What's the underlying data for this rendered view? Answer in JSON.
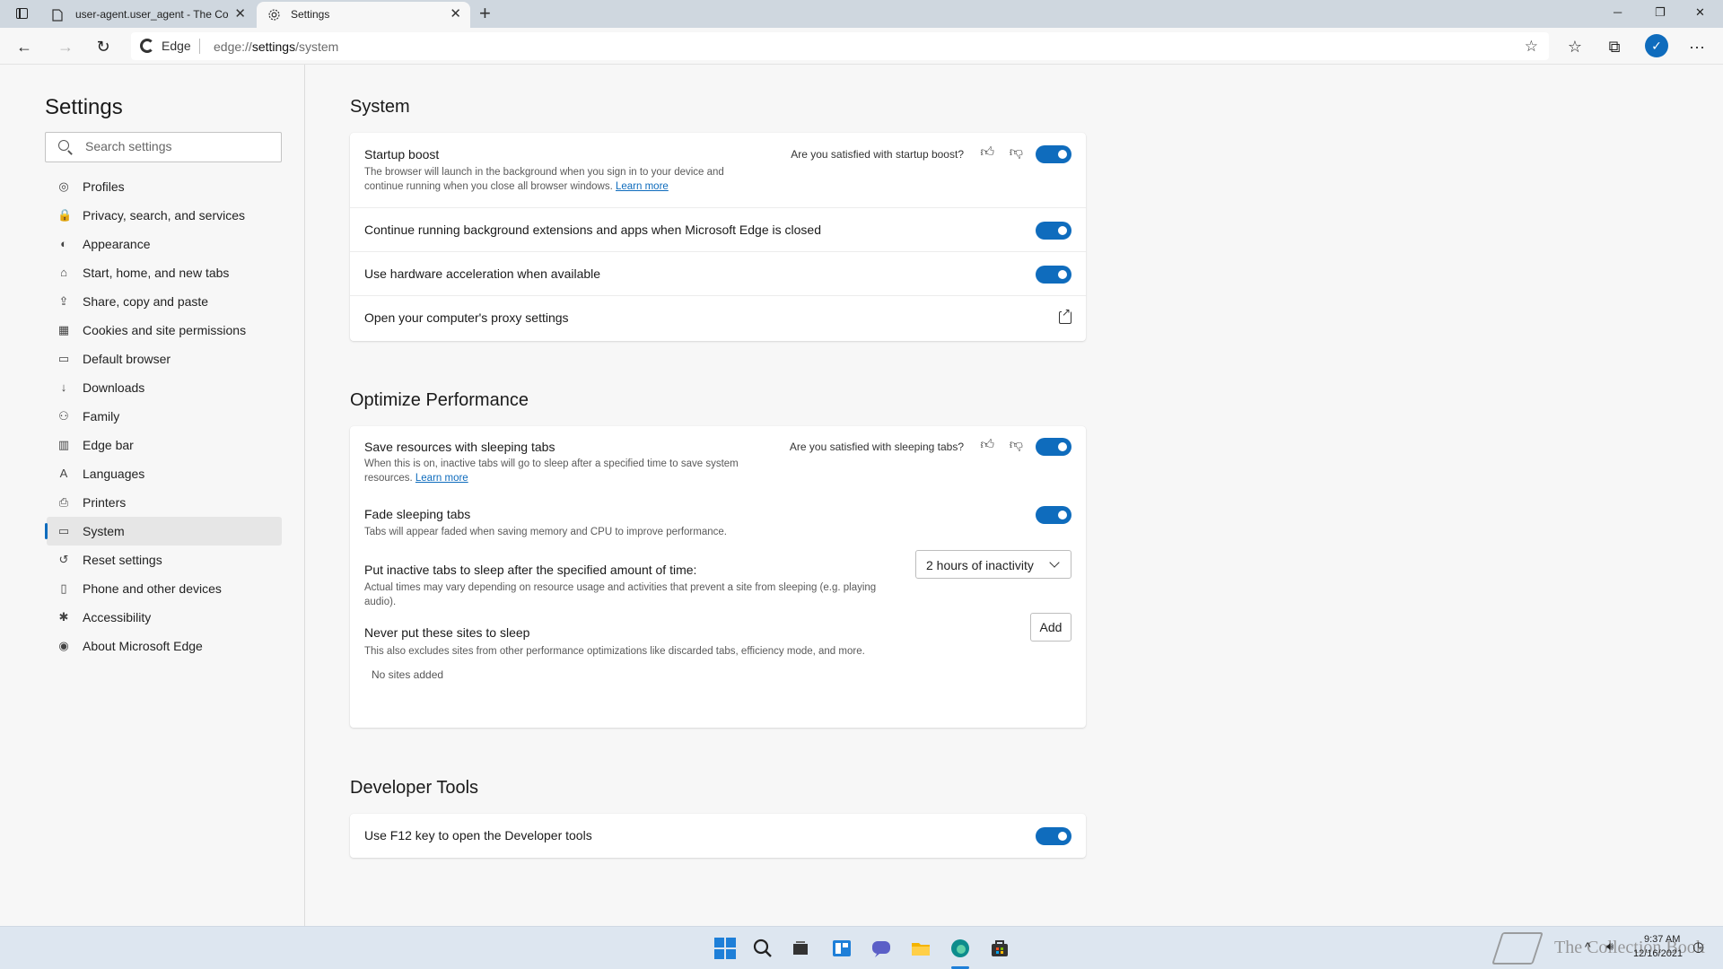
{
  "browser": {
    "tabs": [
      {
        "title": "user-agent.user_agent - The Coll",
        "close": "✕",
        "icon": "page-icon"
      },
      {
        "title": "Settings",
        "close": "✕",
        "icon": "gear-icon"
      }
    ],
    "new_tab": "+",
    "window_controls": {
      "minimize": "─",
      "restore": "❐",
      "close": "✕"
    },
    "address": {
      "chip": "Edge",
      "url_prefix": "edge://",
      "url_main": "settings",
      "url_suffix": "/system"
    },
    "toolbar_icons": {
      "back": "←",
      "forward": "→",
      "refresh": "↻",
      "add_favorite": "☆",
      "favorites": "☆",
      "collections": "⧉",
      "more": "···"
    }
  },
  "sidebar": {
    "title": "Settings",
    "search_placeholder": "Search settings",
    "items": [
      {
        "label": "Profiles",
        "icon": "profile-icon",
        "glyph": "◎"
      },
      {
        "label": "Privacy, search, and services",
        "icon": "lock-icon",
        "glyph": "🔒"
      },
      {
        "label": "Appearance",
        "icon": "appearance-icon",
        "glyph": "◐"
      },
      {
        "label": "Start, home, and new tabs",
        "icon": "home-icon",
        "glyph": "⌂"
      },
      {
        "label": "Share, copy and paste",
        "icon": "share-icon",
        "glyph": "⇪"
      },
      {
        "label": "Cookies and site permissions",
        "icon": "cookie-icon",
        "glyph": "▦"
      },
      {
        "label": "Default browser",
        "icon": "browser-icon",
        "glyph": "▭"
      },
      {
        "label": "Downloads",
        "icon": "download-icon",
        "glyph": "↓"
      },
      {
        "label": "Family",
        "icon": "family-icon",
        "glyph": "⚇"
      },
      {
        "label": "Edge bar",
        "icon": "edge-bar-icon",
        "glyph": "▥"
      },
      {
        "label": "Languages",
        "icon": "language-icon",
        "glyph": "A"
      },
      {
        "label": "Printers",
        "icon": "printer-icon",
        "glyph": "⎙"
      },
      {
        "label": "System",
        "icon": "system-icon",
        "glyph": "▭"
      },
      {
        "label": "Reset settings",
        "icon": "reset-icon",
        "glyph": "↺"
      },
      {
        "label": "Phone and other devices",
        "icon": "phone-icon",
        "glyph": "▯"
      },
      {
        "label": "Accessibility",
        "icon": "accessibility-icon",
        "glyph": "✱"
      },
      {
        "label": "About Microsoft Edge",
        "icon": "edge-logo-icon",
        "glyph": "◉"
      }
    ],
    "selected": "System"
  },
  "main": {
    "system": {
      "title": "System",
      "startup_boost": {
        "title": "Startup boost",
        "desc_line1": "The browser will launch in the background when you sign in to your device and",
        "desc_line2": "continue running when you close all browser windows.",
        "learn_more": "Learn more",
        "feedback": "Are you satisfied with startup boost?",
        "enabled": true
      },
      "background_extensions": {
        "title": "Continue running background extensions and apps when Microsoft Edge is closed",
        "enabled": true
      },
      "hardware_acceleration": {
        "title": "Use hardware acceleration when available",
        "enabled": true
      },
      "proxy": {
        "title": "Open your computer's proxy settings"
      }
    },
    "performance": {
      "title": "Optimize Performance",
      "sleeping_tabs": {
        "title": "Save resources with sleeping tabs",
        "desc_line1": "When this is on, inactive tabs will go to sleep after a specified time to save system",
        "desc_line2": "resources.",
        "learn_more": "Learn more",
        "feedback": "Are you satisfied with sleeping tabs?",
        "enabled": true
      },
      "fade_tabs": {
        "title": "Fade sleeping tabs",
        "desc": "Tabs will appear faded when saving memory and CPU to improve performance.",
        "enabled": true
      },
      "sleep_after": {
        "title": "Put inactive tabs to sleep after the specified amount of time:",
        "desc_line1": "Actual times may vary depending on resource usage and activities that prevent a site from sleeping (e.g. playing",
        "desc_line2": "audio).",
        "value": "2 hours of inactivity"
      },
      "never_sleep": {
        "title": "Never put these sites to sleep",
        "desc": "This also excludes sites from other performance optimizations like discarded tabs, efficiency mode, and more.",
        "add_label": "Add",
        "empty": "No sites added"
      }
    },
    "developer": {
      "title": "Developer Tools",
      "f12": {
        "title": "Use F12 key to open the Developer tools",
        "enabled": true
      }
    }
  },
  "taskbar": {
    "icons": [
      "start-icon",
      "search-icon",
      "task-view-icon",
      "widgets-icon",
      "chat-icon",
      "file-explorer-icon",
      "edge-icon",
      "store-icon"
    ],
    "time": "9:37 AM",
    "date": "12/16/2021",
    "watermark": "The Collection Book"
  },
  "colors": {
    "accent": "#0f6cbd",
    "background": "#f7f7f7",
    "tabstrip": "#cfd7df",
    "taskbar": "#dde6f0"
  }
}
